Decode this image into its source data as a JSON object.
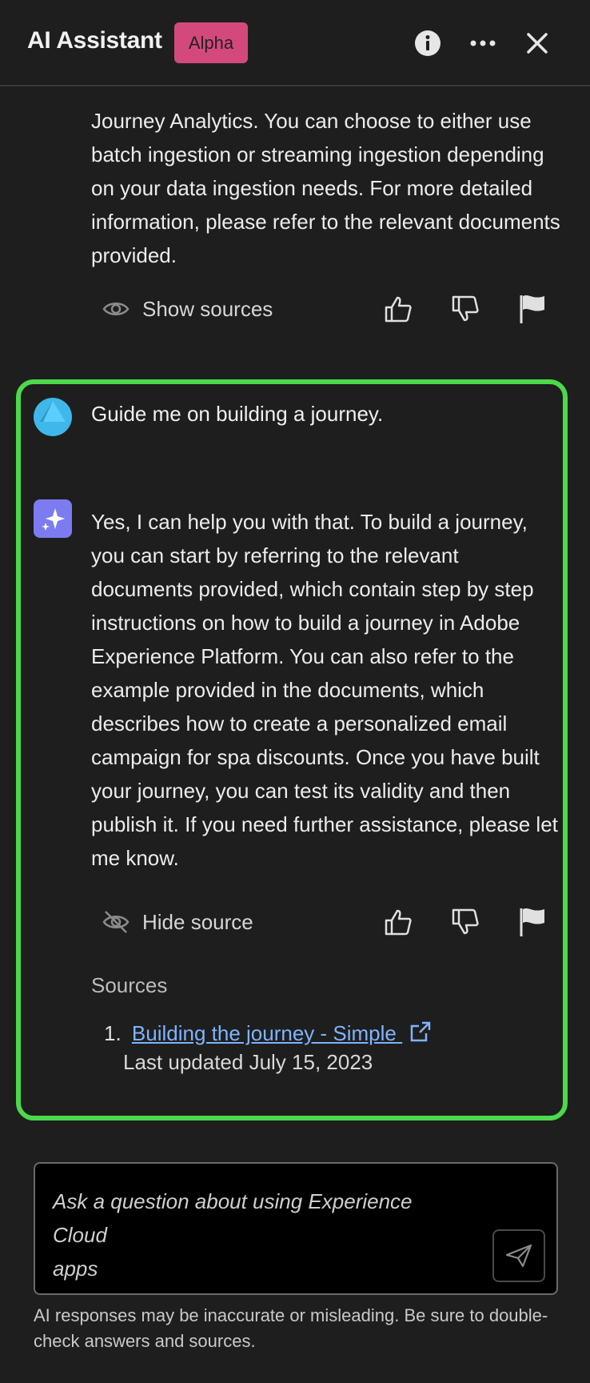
{
  "header": {
    "title": "AI Assistant",
    "badge": "Alpha",
    "icons": [
      "info-icon",
      "more-icon",
      "close-icon"
    ]
  },
  "previous_response": {
    "lines": [
      "Journey Analytics. You can choose to either use",
      "batch ingestion or streaming ingestion depending",
      "on your data ingestion needs. For more detailed",
      "information, please refer to the relevant documents",
      "provided."
    ],
    "show_sources_label": "Show sources"
  },
  "conversation": {
    "user_message": "Guide me on building a journey.",
    "ai_lines": [
      "Yes, I can help you with that. To build a journey,",
      "you can start by referring to the relevant",
      "documents provided, which contain step by step",
      "instructions on how to build a journey in Adobe",
      "Experience Platform. You can also refer to the",
      "example provided in the documents, which",
      "describes how to create a personalized email",
      "campaign for spa discounts. Once you have built",
      "your journey, you can test its validity and then",
      "publish it. If you need further assistance, please let",
      "me know."
    ],
    "hide_source_label": "Hide source",
    "sources_title": "Sources",
    "sources": [
      {
        "number": "1.",
        "title": "Building the journey - Simple",
        "date": "Last updated July 15, 2023"
      }
    ]
  },
  "composer": {
    "placeholder_line1": "Ask a question about using Experience Cloud",
    "placeholder_line2": "apps"
  },
  "disclaimer": {
    "line1": "AI responses may be inaccurate or misleading. Be sure to double-",
    "line2": "check answers and sources."
  },
  "colors": {
    "background": "#1e1e1e",
    "badge": "#d4497c",
    "highlight_border": "#4cd94a",
    "link": "#7fb3ff",
    "ai_avatar": "#7c7cf0",
    "user_avatar": "#3fb7ea"
  }
}
